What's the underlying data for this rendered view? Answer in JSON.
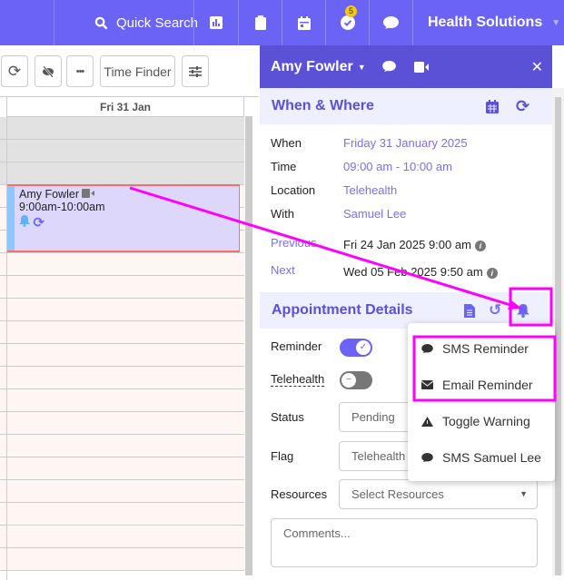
{
  "topbar": {
    "search_label": "Quick Search",
    "notification_count": "5",
    "org_name": "Health Solutions"
  },
  "toolbar": {
    "time_finder": "Time Finder"
  },
  "calendar": {
    "day_header": "Fri 31 Jan",
    "event": {
      "patient": "Amy Fowler",
      "time": "9:00am-10:00am"
    }
  },
  "panel": {
    "patient_name": "Amy Fowler",
    "when_where": {
      "title": "When & Where",
      "rows": [
        {
          "label": "When",
          "value": "Friday 31 January 2025"
        },
        {
          "label": "Time",
          "value": "09:00 am - 10:00 am"
        },
        {
          "label": "Location",
          "value": "Telehealth"
        },
        {
          "label": "With",
          "value": "Samuel Lee"
        }
      ],
      "previous": {
        "label": "Previous",
        "value": "Fri 24 Jan 2025 9:00 am"
      },
      "next": {
        "label": "Next",
        "value": "Wed 05 Feb 2025 9:50 am"
      }
    },
    "details": {
      "title": "Appointment Details",
      "reminder_label": "Reminder",
      "reminder_on": true,
      "telehealth_label": "Telehealth",
      "telehealth_on": false,
      "status_label": "Status",
      "status_value": "Pending",
      "flag_label": "Flag",
      "flag_value": "Telehealth",
      "resources_label": "Resources",
      "resources_placeholder": "Select Resources",
      "comments_placeholder": "Comments..."
    }
  },
  "reminder_menu": {
    "items": [
      {
        "label": "SMS Reminder",
        "icon": "comment-icon"
      },
      {
        "label": "Email Reminder",
        "icon": "envelope-icon"
      },
      {
        "label": "Toggle Warning",
        "icon": "warning-icon"
      },
      {
        "label": "SMS Samuel Lee",
        "icon": "comment-icon"
      }
    ]
  },
  "colors": {
    "topbar": "#6a63f5",
    "panel_header": "#5a51d7",
    "annotation": "#ff00ff",
    "event_bg": "#ddd8fb"
  }
}
